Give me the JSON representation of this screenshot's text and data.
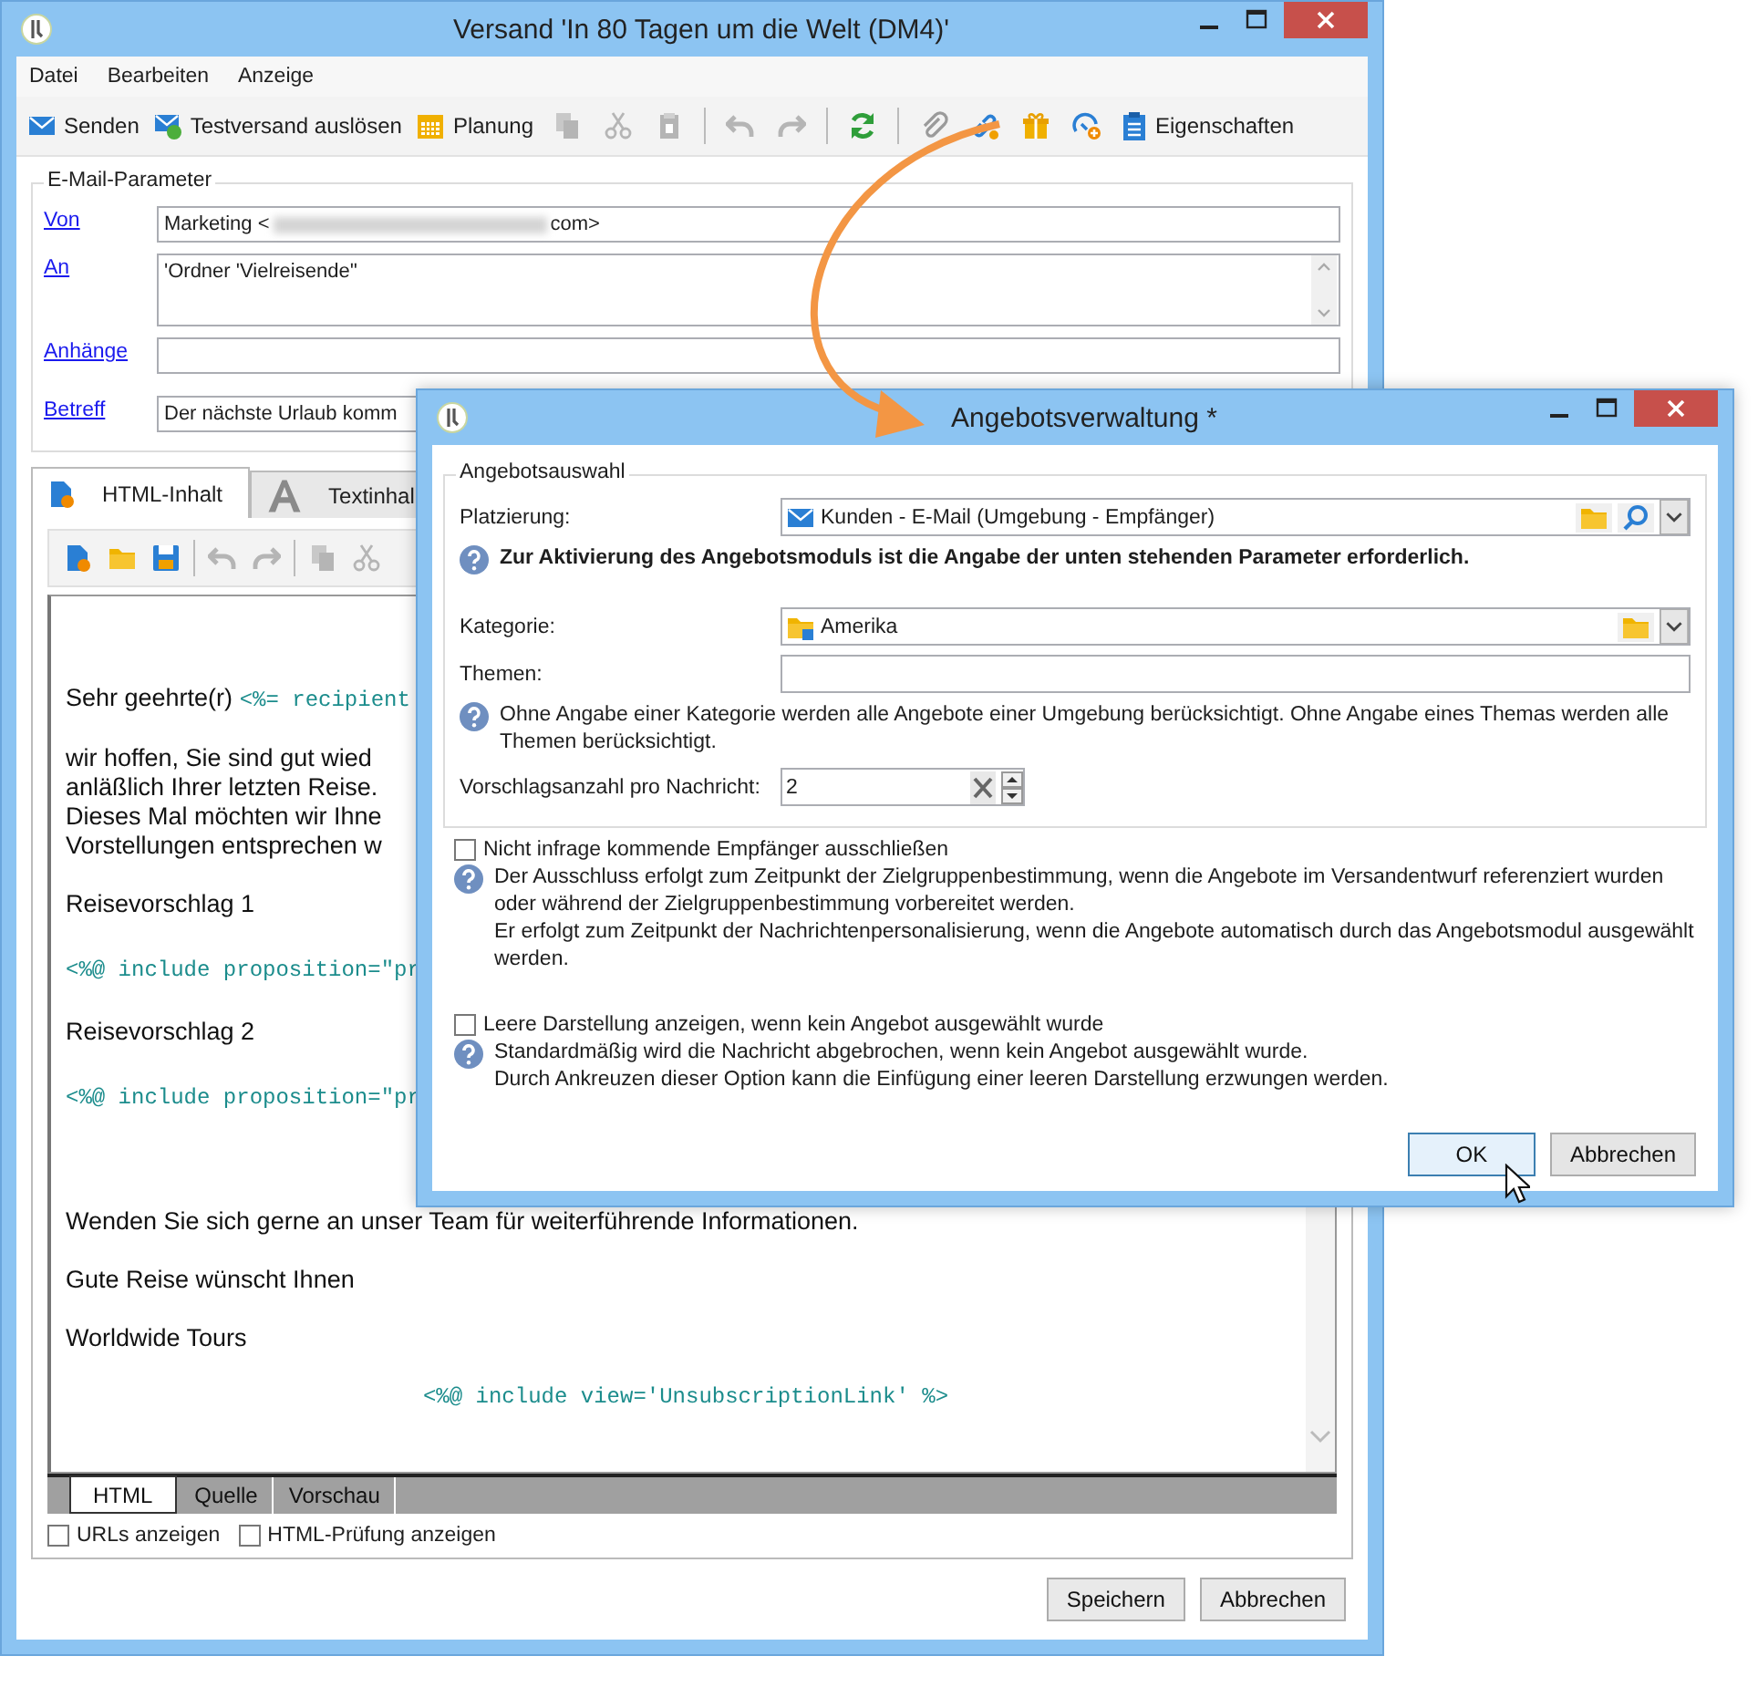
{
  "main_window": {
    "title": "Versand 'In 80 Tagen um die Welt (DM4)'"
  },
  "menu": [
    "Datei",
    "Bearbeiten",
    "Anzeige"
  ],
  "toolbar": [
    {
      "kind": "button",
      "label": "Senden",
      "disabled": false
    },
    {
      "kind": "button",
      "label": "Testversand auslösen",
      "disabled": false
    },
    {
      "kind": "button",
      "label": "Planung",
      "disabled": false
    },
    {
      "kind": "icon",
      "disabled": true
    },
    {
      "kind": "icon",
      "disabled": true
    },
    {
      "kind": "icon",
      "disabled": true
    },
    {
      "kind": "separator"
    },
    {
      "kind": "icon",
      "disabled": true
    },
    {
      "kind": "icon",
      "disabled": true
    },
    {
      "kind": "separator"
    },
    {
      "kind": "icon",
      "disabled": false
    },
    {
      "kind": "separator"
    },
    {
      "kind": "icon",
      "disabled": false
    },
    {
      "kind": "icon",
      "disabled": false
    },
    {
      "kind": "icon",
      "disabled": false
    },
    {
      "kind": "icon",
      "disabled": false
    },
    {
      "kind": "button",
      "label": "Eigenschaften",
      "disabled": false
    }
  ],
  "email_parameters": {
    "title": "E-Mail-Parameter",
    "fields": [
      {
        "kind": "masked",
        "label": "Von",
        "prefix": "Marketing <",
        "suffix": "com>"
      },
      {
        "kind": "multiline",
        "label": "An",
        "value": "'Ordner 'Vielreisende''"
      },
      {
        "kind": "single",
        "label": "Anhänge"
      },
      {
        "kind": "single",
        "label": "Betreff",
        "value": "Der nächste Urlaub komm"
      }
    ]
  },
  "content_tabs": [
    {
      "label": "HTML-Inhalt",
      "selected": true
    },
    {
      "label": "Textinhal",
      "selected": false
    }
  ],
  "editor_toolbar": [
    {
      "kind": "icon",
      "disabled": false
    },
    {
      "kind": "icon",
      "disabled": false
    },
    {
      "kind": "icon",
      "disabled": false
    },
    {
      "kind": "separator"
    },
    {
      "kind": "icon",
      "disabled": true
    },
    {
      "kind": "icon",
      "disabled": true
    },
    {
      "kind": "separator"
    },
    {
      "kind": "icon",
      "disabled": true
    },
    {
      "kind": "icon",
      "disabled": true
    }
  ],
  "editor_body": [
    {
      "kind": "greeting",
      "text": "Sehr geehrte(r)",
      "code": "<%= recipient"
    },
    {
      "kind": "text",
      "lines": [
        "wir hoffen, Sie sind gut wied",
        "anläßlich Ihrer letzten Reise.",
        "Dieses Mal möchten wir Ihne",
        "Vorstellungen entsprechen w"
      ]
    },
    {
      "kind": "text",
      "lines": [
        "Reisevorschlag 1"
      ]
    },
    {
      "kind": "code",
      "lines": [
        "<%@ include proposition=\"pr"
      ]
    },
    {
      "kind": "text",
      "lines": [
        "Reisevorschlag 2"
      ]
    },
    {
      "kind": "code",
      "lines": [
        "<%@ include proposition=\"pr"
      ]
    },
    {
      "kind": "text",
      "lines": [
        "Wenden Sie sich gerne an unser Team für weiterführende Informationen."
      ]
    },
    {
      "kind": "text",
      "lines": [
        "Gute Reise wünscht Ihnen"
      ]
    },
    {
      "kind": "text",
      "lines": [
        "Worldwide Tours"
      ]
    },
    {
      "kind": "code-center",
      "lines": [
        "<%@ include view='UnsubscriptionLink' %>"
      ]
    }
  ],
  "view_tabs": [
    {
      "label": "HTML",
      "selected": true
    },
    {
      "label": "Quelle",
      "selected": false
    },
    {
      "label": "Vorschau",
      "selected": false
    }
  ],
  "options": [
    {
      "label": "URLs anzeigen",
      "checked": false
    },
    {
      "label": "HTML-Prüfung anzeigen",
      "checked": false
    }
  ],
  "buttons": [
    "Speichern",
    "Abbrechen"
  ],
  "dialog": {
    "title": "Angebotsverwaltung *",
    "group": "Angebotsauswahl",
    "placement": {
      "label": "Platzierung:",
      "value": "Kunden - E-Mail (Umgebung - Empfänger)"
    },
    "placement_hint": "Zur Aktivierung des Angebotsmoduls ist die Angabe der unten stehenden Parameter erforderlich.",
    "category": {
      "label": "Kategorie:",
      "value": "Amerika"
    },
    "themes": {
      "label": "Themen:"
    },
    "themes_hint": "Ohne Angabe einer Kategorie werden alle Angebote einer Umgebung berücksichtigt. Ohne Angabe eines Themas werden alle Themen berücksichtigt.",
    "count": {
      "label": "Vorschlagsanzahl pro Nachricht:",
      "value": "2"
    },
    "options": [
      {
        "label": "Nicht infrage kommende Empfänger ausschließen",
        "checked": false,
        "hint": [
          "Der Ausschluss erfolgt zum Zeitpunkt der Zielgruppenbestimmung, wenn die Angebote im Versandentwurf referenziert wurden oder während der Zielgruppenbestimmung vorbereitet werden.",
          "Er erfolgt zum Zeitpunkt der Nachrichtenpersonalisierung, wenn die Angebote automatisch durch das Angebotsmodul ausgewählt werden."
        ]
      },
      {
        "label": "Leere Darstellung anzeigen, wenn kein Angebot ausgewählt wurde",
        "checked": false,
        "hint": [
          "Standardmäßig wird die Nachricht abgebrochen, wenn kein Angebot ausgewählt wurde.",
          "Durch Ankreuzen dieser Option kann die Einfügung einer leeren Darstellung erzwungen werden."
        ]
      }
    ],
    "buttons": [
      {
        "label": "OK",
        "default": true
      },
      {
        "label": "Abbrechen",
        "default": false
      }
    ]
  }
}
